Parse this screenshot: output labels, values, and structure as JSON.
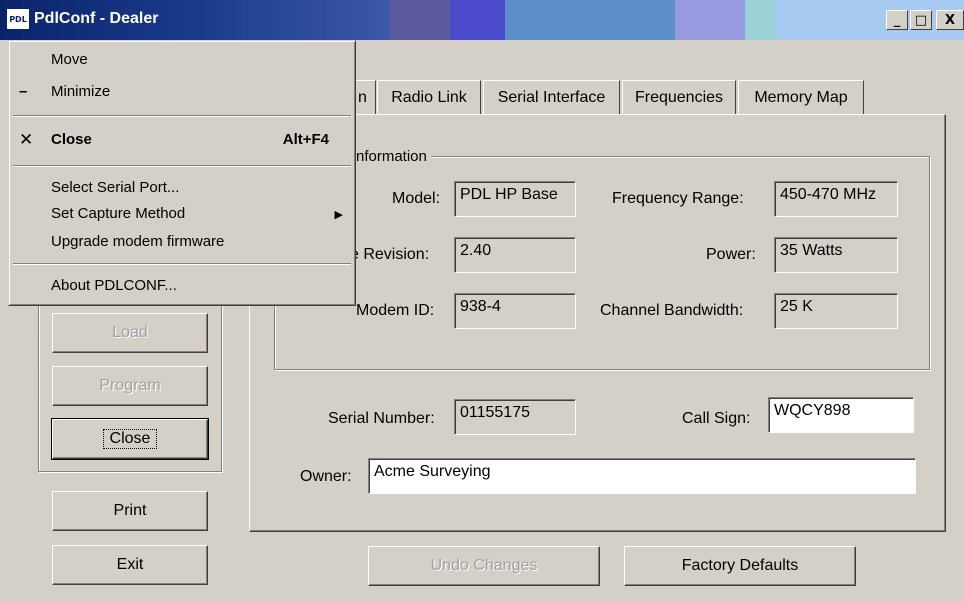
{
  "window": {
    "icon_text": "PDL",
    "title": "PdlConf - Dealer",
    "minimize_glyph": "_",
    "maximize_glyph": "□",
    "close_glyph": "X"
  },
  "tabs": [
    {
      "label": "n"
    },
    {
      "label": "Radio Link"
    },
    {
      "label": "Serial Interface"
    },
    {
      "label": "Frequencies"
    },
    {
      "label": "Memory Map"
    }
  ],
  "info_group": {
    "legend": "nformation",
    "model_label": "Model:",
    "model_value": "PDL HP Base",
    "revision_label": "e Revision:",
    "revision_value": "2.40",
    "modem_id_label": "Modem ID:",
    "modem_id_value": "938-4",
    "freq_range_label": "Frequency Range:",
    "freq_range_value": "450-470 MHz",
    "power_label": "Power:",
    "power_value": "35 Watts",
    "bandwidth_label": "Channel Bandwidth:",
    "bandwidth_value": "25 K"
  },
  "details": {
    "serial_label": "Serial Number:",
    "serial_value": "01155175",
    "callsign_label": "Call Sign:",
    "callsign_value": "WQCY898",
    "owner_label": "Owner:",
    "owner_value": "Acme Surveying"
  },
  "left_buttons": {
    "load": "Load",
    "program": "Program",
    "close": "Close",
    "print": "Print",
    "exit": "Exit"
  },
  "bottom_buttons": {
    "undo": "Undo Changes",
    "factory": "Factory Defaults"
  },
  "system_menu": {
    "move": "Move",
    "minimize": "Minimize",
    "minimize_glyph": "–",
    "close": "Close",
    "close_glyph": "✕",
    "close_shortcut": "Alt+F4",
    "select_port": "Select Serial Port...",
    "capture": "Set Capture Method",
    "capture_arrow": "▶",
    "upgrade": "Upgrade modem firmware",
    "about": "About PDLCONF..."
  }
}
